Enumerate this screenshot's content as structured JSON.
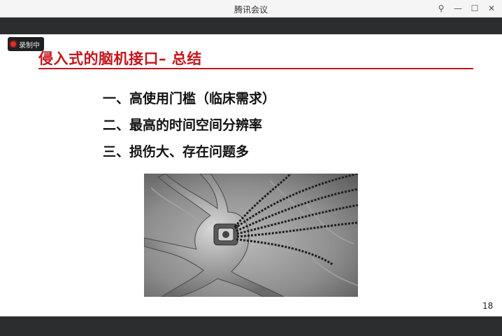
{
  "window": {
    "title": "腾讯会议",
    "controls": [
      {
        "name": "pin-icon",
        "glyph": "⚲"
      },
      {
        "name": "minimize-icon",
        "glyph": "—"
      },
      {
        "name": "maximize-icon",
        "glyph": "☐"
      },
      {
        "name": "close-icon",
        "glyph": "✕"
      }
    ]
  },
  "recording": {
    "label": "录制中",
    "dot_color": "#e02b2b"
  },
  "slide": {
    "title": "侵入式的脑机接口– 总结",
    "accent_color": "#c4151c",
    "points": [
      "一、高使用门槛（临床需求）",
      "二、最高的时间空间分辨率",
      "三、损伤大、存在问题多"
    ],
    "page_number": "18"
  }
}
